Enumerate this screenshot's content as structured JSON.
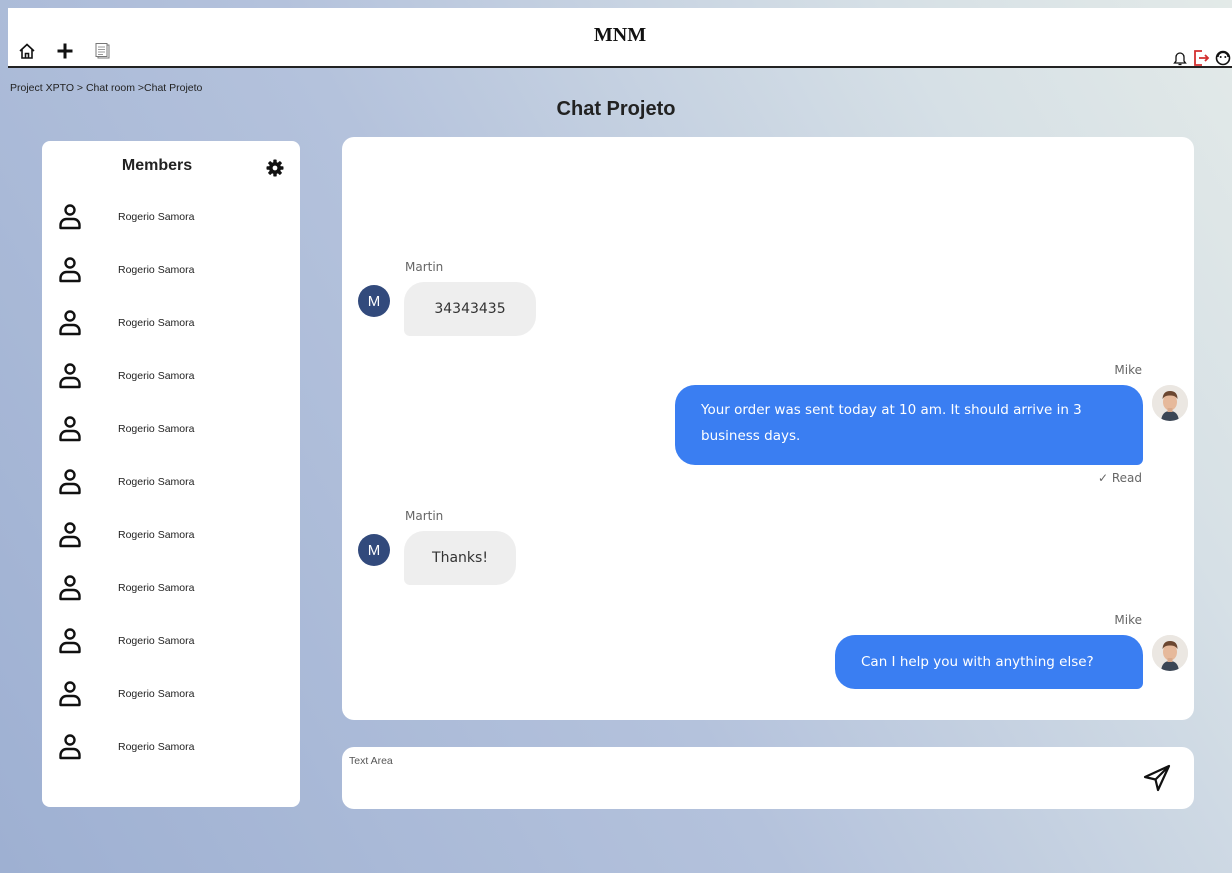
{
  "app": {
    "brand": "MNM"
  },
  "toolbar": {
    "left_icons": [
      "home-icon",
      "plus-icon",
      "notes-icon"
    ],
    "right_icons": [
      "bell-icon",
      "logout-icon",
      "profile-icon"
    ],
    "logout_color": "#d32f2f"
  },
  "breadcrumb": "Project XPTO > Chat room >Chat Projeto",
  "page_title": "Chat Projeto",
  "members": {
    "title": "Members",
    "settings_icon": "gear-icon",
    "items": [
      {
        "name": "Rogerio Samora"
      },
      {
        "name": "Rogerio Samora"
      },
      {
        "name": "Rogerio Samora"
      },
      {
        "name": "Rogerio Samora"
      },
      {
        "name": "Rogerio Samora"
      },
      {
        "name": "Rogerio Samora"
      },
      {
        "name": "Rogerio Samora"
      },
      {
        "name": "Rogerio Samora"
      },
      {
        "name": "Rogerio Samora"
      },
      {
        "name": "Rogerio Samora"
      },
      {
        "name": "Rogerio Samora"
      }
    ]
  },
  "chat": {
    "accent_color": "#3a7ef2",
    "messages": [
      {
        "sender": "Martin",
        "avatar_letter": "M",
        "text": "34343435",
        "direction": "in"
      },
      {
        "sender": "Mike",
        "text": "Your order was sent today at 10 am. It should arrive in 3 business days.",
        "direction": "out",
        "status": "Read"
      },
      {
        "sender": "Martin",
        "avatar_letter": "M",
        "text": "Thanks!",
        "direction": "in"
      },
      {
        "sender": "Mike",
        "text": "Can I help you with anything else?",
        "direction": "out"
      }
    ]
  },
  "composer": {
    "placeholder": "Text Area",
    "send_icon": "send-icon"
  }
}
